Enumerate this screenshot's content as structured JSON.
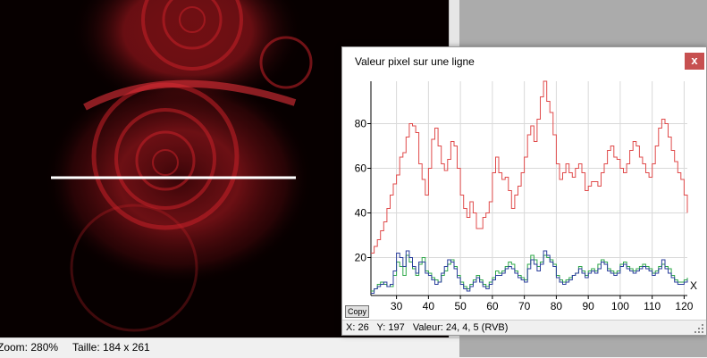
{
  "image_view": {
    "zoom_text": "Zoom: 280%",
    "size_text": "Taille: 184 x 261"
  },
  "profile_window": {
    "title": "Valeur pixel sur une ligne",
    "close_label": "x",
    "copy_label": "Copy",
    "status": {
      "x_text": "X: 26",
      "y_text": "Y: 197",
      "value_text": "Valeur: 24, 4, 5 (RVB)"
    }
  },
  "colors": {
    "red_series": "#e04b4b",
    "green_series": "#2fa84a",
    "blue_series": "#2b3f9c",
    "line_selection": "#ffffff",
    "close_button": "#c75050"
  },
  "chart_data": {
    "type": "line",
    "title": "",
    "xlabel": "X",
    "ylabel": "",
    "xlim": [
      22,
      121
    ],
    "ylim": [
      3,
      99
    ],
    "x_ticks": [
      30,
      40,
      50,
      60,
      70,
      80,
      90,
      100,
      110,
      120
    ],
    "y_ticks": [
      20,
      40,
      60,
      80
    ],
    "grid": true,
    "step": true,
    "x": [
      22,
      23,
      24,
      25,
      26,
      27,
      28,
      29,
      30,
      31,
      32,
      33,
      34,
      35,
      36,
      37,
      38,
      39,
      40,
      41,
      42,
      43,
      44,
      45,
      46,
      47,
      48,
      49,
      50,
      51,
      52,
      53,
      54,
      55,
      56,
      57,
      58,
      59,
      60,
      61,
      62,
      63,
      64,
      65,
      66,
      67,
      68,
      69,
      70,
      71,
      72,
      73,
      74,
      75,
      76,
      77,
      78,
      79,
      80,
      81,
      82,
      83,
      84,
      85,
      86,
      87,
      88,
      89,
      90,
      91,
      92,
      93,
      94,
      95,
      96,
      97,
      98,
      99,
      100,
      101,
      102,
      103,
      104,
      105,
      106,
      107,
      108,
      109,
      110,
      111,
      112,
      113,
      114,
      115,
      116,
      117,
      118,
      119,
      120,
      121
    ],
    "series": [
      {
        "values": [
          22,
          25,
          28,
          32,
          36,
          42,
          48,
          53,
          57,
          65,
          67,
          74,
          80,
          79,
          76,
          62,
          55,
          48,
          60,
          73,
          78,
          70,
          62,
          59,
          64,
          72,
          70,
          60,
          48,
          42,
          38,
          45,
          40,
          33,
          33,
          38,
          40,
          45,
          58,
          65,
          58,
          55,
          56,
          50,
          42,
          48,
          52,
          58,
          65,
          75,
          79,
          72,
          82,
          92,
          99,
          90,
          85,
          75,
          62,
          55,
          58,
          62,
          58,
          56,
          60,
          62,
          58,
          50,
          52,
          54,
          54,
          52,
          58,
          62,
          68,
          70,
          65,
          64,
          60,
          58,
          62,
          68,
          72,
          70,
          65,
          62,
          58,
          56,
          62,
          70,
          78,
          82,
          80,
          74,
          68,
          63,
          58,
          55,
          48,
          40,
          38,
          33
        ]
      },
      {
        "values": [
          5,
          6,
          8,
          9,
          8,
          7,
          7,
          12,
          18,
          16,
          12,
          21,
          18,
          15,
          12,
          17,
          20,
          14,
          13,
          11,
          10,
          9,
          12,
          14,
          17,
          19,
          16,
          12,
          9,
          7,
          6,
          8,
          10,
          12,
          10,
          8,
          7,
          9,
          11,
          14,
          13,
          14,
          16,
          18,
          17,
          14,
          12,
          11,
          10,
          17,
          21,
          19,
          16,
          18,
          21,
          20,
          19,
          17,
          12,
          10,
          9,
          10,
          11,
          12,
          13,
          16,
          14,
          12,
          14,
          15,
          14,
          17,
          19,
          18,
          15,
          14,
          13,
          14,
          17,
          18,
          16,
          15,
          14,
          15,
          16,
          17,
          16,
          15,
          13,
          14,
          16,
          17,
          16,
          15,
          12,
          10,
          9,
          9,
          10,
          11,
          10,
          9
        ]
      },
      {
        "values": [
          4,
          6,
          7,
          8,
          9,
          7,
          8,
          14,
          22,
          20,
          16,
          23,
          20,
          16,
          13,
          18,
          18,
          13,
          12,
          10,
          8,
          9,
          13,
          16,
          19,
          18,
          15,
          11,
          8,
          6,
          5,
          7,
          9,
          11,
          9,
          7,
          6,
          8,
          10,
          12,
          12,
          13,
          15,
          16,
          15,
          13,
          11,
          10,
          9,
          15,
          19,
          17,
          14,
          17,
          23,
          21,
          18,
          16,
          11,
          9,
          8,
          9,
          10,
          12,
          13,
          15,
          13,
          11,
          13,
          14,
          13,
          15,
          18,
          17,
          14,
          13,
          12,
          13,
          16,
          17,
          15,
          14,
          13,
          14,
          15,
          16,
          15,
          14,
          12,
          13,
          15,
          19,
          15,
          13,
          11,
          9,
          8,
          8,
          9,
          10,
          9,
          8
        ]
      }
    ]
  }
}
